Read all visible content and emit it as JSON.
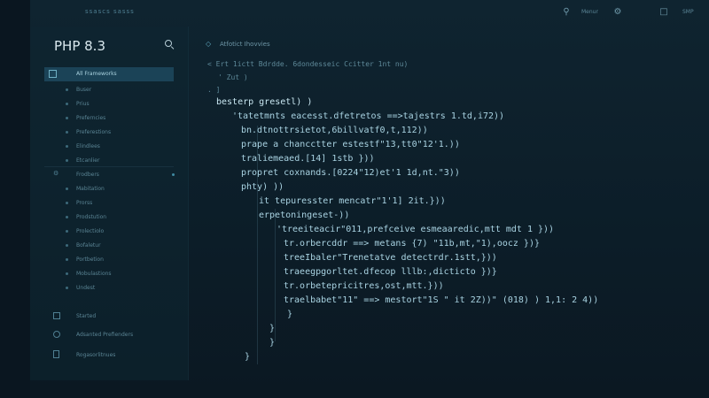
{
  "topbar": {
    "title": "ssascs sasss",
    "menu_label": "Menur",
    "user_label": "SMP"
  },
  "sidebar": {
    "title": "PHP 8.3",
    "items": [
      {
        "label": "All Frameworks",
        "active": true
      },
      {
        "label": "Buser"
      },
      {
        "label": "Prius"
      },
      {
        "label": "Preferncies"
      },
      {
        "label": "Preferestions"
      },
      {
        "label": "Elindlees"
      },
      {
        "label": "Etcanlier"
      },
      {
        "label": "Frodbers"
      },
      {
        "label": "Mabitation"
      },
      {
        "label": "Prorss"
      },
      {
        "label": "Prodstution"
      },
      {
        "label": "Prolectiolo"
      },
      {
        "label": "Bofaletur"
      },
      {
        "label": "Portbetion"
      },
      {
        "label": "Mobulastions"
      },
      {
        "label": "Undest"
      }
    ],
    "footer": [
      {
        "label": "Started"
      },
      {
        "label": "Adsanted Prefienders"
      },
      {
        "label": "Rogasorlitnues"
      }
    ]
  },
  "editor": {
    "tab_label": "Atfotict Ihovvies",
    "lines": [
      "< Ert 1ictt Bdrdde. 6dondesseic Ccitter 1nt nu)",
      "' Zut )",
      ". ]",
      "besterp gresetl) )",
      "'tatetmnts eacesst.dfetretos ==>tajestrs 1.td,i72))",
      "bn.dtnottrsietot,6billvatf0,t,112))",
      "prape a chancctter estestf\"13,tt0\"12'1.))",
      "traliemeaed.[14] 1stb }))",
      "propret coxnands.[0224\"12)et'1 1d,nt.\"3))",
      "phty) ))",
      "it tepuresster mencatr\"1'1] 2it.}))",
      "erpetoningeset-))",
      "'treeiteacir\"011,prefceive esmeaaredic,mtt mdt 1 }))",
      "tr.orbercddr ==> metans {7) \"11b,mt,\"1),oocz })}",
      "treeIbaler\"Trenetatve detectrdr.1stt,}))",
      "traeegpgorltet.dfecop lllb:,dicticto })}",
      "tr.orbetepricitres,ost,mtt.}))",
      "traelbabet\"11\" ==> mestort\"1S \" it 2Z))\" (018) ) 1,1: 2 4))",
      "}",
      "}",
      "}",
      "}"
    ]
  }
}
